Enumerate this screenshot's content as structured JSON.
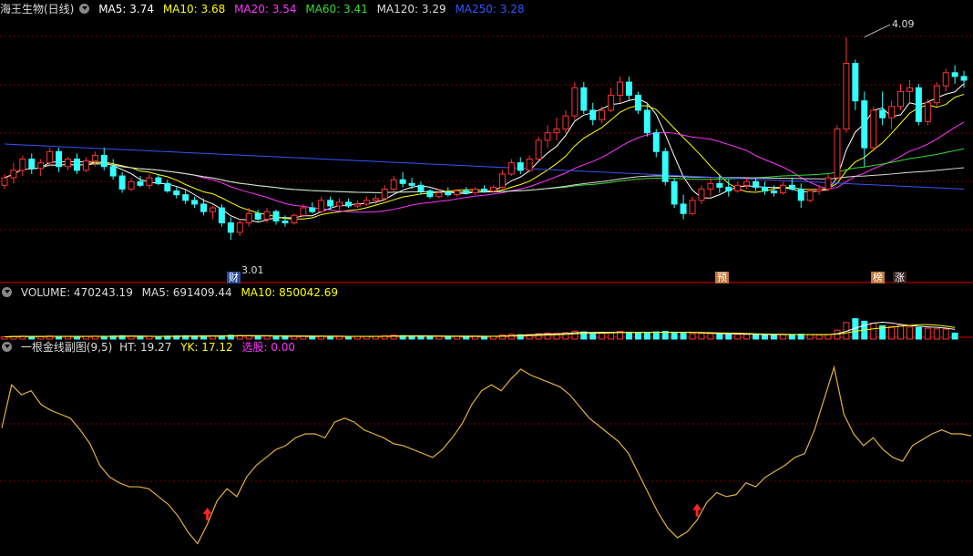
{
  "main": {
    "title": "海王生物(日线)",
    "ma": [
      {
        "label": "MA5: 3.74",
        "color": "#ffffff"
      },
      {
        "label": "MA10: 3.68",
        "color": "#ffff00"
      },
      {
        "label": "MA20: 3.54",
        "color": "#ff33ff"
      },
      {
        "label": "MA60: 3.41",
        "color": "#33dd33"
      },
      {
        "label": "MA120: 3.29",
        "color": "#dddddd"
      },
      {
        "label": "MA250: 3.28",
        "color": "#3355ff"
      }
    ],
    "high_label": "4.09",
    "low_label": "3.01",
    "tags": [
      {
        "text": "财",
        "bg": "#2a4fa0"
      },
      {
        "text": "预",
        "bg": "#c0783a"
      },
      {
        "text": "榜",
        "bg": "#c0783a"
      },
      {
        "text": "涨",
        "bg": "#3a2020"
      }
    ]
  },
  "volume": {
    "title": "VOLUME: 470243.19",
    "ma5": "MA5: 691409.44",
    "ma10": "MA10: 850042.69"
  },
  "indicator": {
    "title": "一根金线副图(9,5)",
    "ht": "HT: 19.27",
    "yk": "YK: 17.12",
    "xg": "选股: 0.00"
  },
  "colors": {
    "up": "#ff3333",
    "down": "#33ffff",
    "grid": "#7a0000",
    "gold": "#e0b040"
  },
  "chart_data": {
    "type": "candlestick",
    "price_range": [
      2.85,
      4.2
    ],
    "candles": [
      [
        3.3,
        3.36,
        3.28,
        3.34
      ],
      [
        3.34,
        3.42,
        3.31,
        3.38
      ],
      [
        3.38,
        3.46,
        3.35,
        3.44
      ],
      [
        3.44,
        3.47,
        3.36,
        3.39
      ],
      [
        3.39,
        3.44,
        3.35,
        3.42
      ],
      [
        3.42,
        3.5,
        3.4,
        3.48
      ],
      [
        3.48,
        3.5,
        3.37,
        3.4
      ],
      [
        3.4,
        3.45,
        3.38,
        3.44
      ],
      [
        3.44,
        3.47,
        3.36,
        3.38
      ],
      [
        3.38,
        3.45,
        3.37,
        3.43
      ],
      [
        3.43,
        3.48,
        3.4,
        3.46
      ],
      [
        3.46,
        3.5,
        3.38,
        3.4
      ],
      [
        3.4,
        3.44,
        3.33,
        3.35
      ],
      [
        3.35,
        3.37,
        3.26,
        3.28
      ],
      [
        3.28,
        3.34,
        3.27,
        3.32
      ],
      [
        3.32,
        3.35,
        3.29,
        3.3
      ],
      [
        3.3,
        3.36,
        3.28,
        3.34
      ],
      [
        3.34,
        3.36,
        3.3,
        3.31
      ],
      [
        3.31,
        3.33,
        3.26,
        3.27
      ],
      [
        3.27,
        3.29,
        3.23,
        3.25
      ],
      [
        3.25,
        3.28,
        3.2,
        3.22
      ],
      [
        3.22,
        3.24,
        3.18,
        3.2
      ],
      [
        3.2,
        3.23,
        3.14,
        3.16
      ],
      [
        3.16,
        3.19,
        3.12,
        3.18
      ],
      [
        3.18,
        3.2,
        3.08,
        3.1
      ],
      [
        3.1,
        3.13,
        3.01,
        3.05
      ],
      [
        3.05,
        3.12,
        3.03,
        3.1
      ],
      [
        3.1,
        3.18,
        3.08,
        3.15
      ],
      [
        3.15,
        3.17,
        3.11,
        3.12
      ],
      [
        3.12,
        3.18,
        3.1,
        3.16
      ],
      [
        3.16,
        3.17,
        3.09,
        3.11
      ],
      [
        3.11,
        3.14,
        3.08,
        3.1
      ],
      [
        3.1,
        3.15,
        3.09,
        3.14
      ],
      [
        3.14,
        3.2,
        3.13,
        3.18
      ],
      [
        3.18,
        3.21,
        3.15,
        3.16
      ],
      [
        3.16,
        3.24,
        3.15,
        3.22
      ],
      [
        3.22,
        3.24,
        3.17,
        3.19
      ],
      [
        3.19,
        3.23,
        3.17,
        3.21
      ],
      [
        3.21,
        3.23,
        3.18,
        3.19
      ],
      [
        3.19,
        3.22,
        3.18,
        3.2
      ],
      [
        3.2,
        3.24,
        3.19,
        3.22
      ],
      [
        3.22,
        3.25,
        3.2,
        3.23
      ],
      [
        3.23,
        3.3,
        3.22,
        3.28
      ],
      [
        3.28,
        3.35,
        3.27,
        3.33
      ],
      [
        3.33,
        3.37,
        3.29,
        3.31
      ],
      [
        3.31,
        3.34,
        3.28,
        3.3
      ],
      [
        3.3,
        3.32,
        3.25,
        3.27
      ],
      [
        3.27,
        3.28,
        3.23,
        3.24
      ],
      [
        3.24,
        3.28,
        3.23,
        3.26
      ],
      [
        3.26,
        3.29,
        3.24,
        3.25
      ],
      [
        3.25,
        3.28,
        3.24,
        3.27
      ],
      [
        3.27,
        3.29,
        3.25,
        3.26
      ],
      [
        3.26,
        3.29,
        3.25,
        3.28
      ],
      [
        3.28,
        3.3,
        3.26,
        3.27
      ],
      [
        3.27,
        3.3,
        3.26,
        3.29
      ],
      [
        3.29,
        3.38,
        3.28,
        3.36
      ],
      [
        3.36,
        3.44,
        3.35,
        3.42
      ],
      [
        3.42,
        3.45,
        3.36,
        3.38
      ],
      [
        3.38,
        3.46,
        3.37,
        3.44
      ],
      [
        3.44,
        3.56,
        3.43,
        3.54
      ],
      [
        3.54,
        3.62,
        3.5,
        3.58
      ],
      [
        3.58,
        3.66,
        3.54,
        3.6
      ],
      [
        3.6,
        3.7,
        3.58,
        3.67
      ],
      [
        3.67,
        3.85,
        3.65,
        3.82
      ],
      [
        3.82,
        3.85,
        3.68,
        3.7
      ],
      [
        3.7,
        3.74,
        3.62,
        3.65
      ],
      [
        3.65,
        3.72,
        3.63,
        3.7
      ],
      [
        3.7,
        3.82,
        3.69,
        3.78
      ],
      [
        3.78,
        3.88,
        3.74,
        3.85
      ],
      [
        3.85,
        3.88,
        3.75,
        3.78
      ],
      [
        3.78,
        3.8,
        3.68,
        3.7
      ],
      [
        3.7,
        3.74,
        3.56,
        3.58
      ],
      [
        3.58,
        3.6,
        3.45,
        3.48
      ],
      [
        3.48,
        3.5,
        3.3,
        3.32
      ],
      [
        3.32,
        3.34,
        3.18,
        3.2
      ],
      [
        3.2,
        3.25,
        3.12,
        3.15
      ],
      [
        3.15,
        3.24,
        3.14,
        3.22
      ],
      [
        3.22,
        3.3,
        3.2,
        3.28
      ],
      [
        3.28,
        3.34,
        3.24,
        3.31
      ],
      [
        3.31,
        3.36,
        3.26,
        3.29
      ],
      [
        3.29,
        3.33,
        3.24,
        3.27
      ],
      [
        3.27,
        3.32,
        3.26,
        3.3
      ],
      [
        3.3,
        3.34,
        3.28,
        3.32
      ],
      [
        3.32,
        3.34,
        3.27,
        3.29
      ],
      [
        3.29,
        3.32,
        3.25,
        3.27
      ],
      [
        3.27,
        3.3,
        3.24,
        3.26
      ],
      [
        3.26,
        3.32,
        3.25,
        3.3
      ],
      [
        3.3,
        3.34,
        3.27,
        3.28
      ],
      [
        3.28,
        3.31,
        3.18,
        3.22
      ],
      [
        3.22,
        3.28,
        3.21,
        3.27
      ],
      [
        3.27,
        3.3,
        3.25,
        3.28
      ],
      [
        3.28,
        3.36,
        3.27,
        3.34
      ],
      [
        3.34,
        3.62,
        3.33,
        3.6
      ],
      [
        3.6,
        4.09,
        3.58,
        3.95
      ],
      [
        3.95,
        3.97,
        3.7,
        3.75
      ],
      [
        3.75,
        3.8,
        3.4,
        3.5
      ],
      [
        3.5,
        3.72,
        3.48,
        3.7
      ],
      [
        3.7,
        3.8,
        3.62,
        3.66
      ],
      [
        3.66,
        3.75,
        3.6,
        3.72
      ],
      [
        3.72,
        3.84,
        3.7,
        3.8
      ],
      [
        3.8,
        3.86,
        3.74,
        3.82
      ],
      [
        3.82,
        3.84,
        3.62,
        3.64
      ],
      [
        3.64,
        3.76,
        3.62,
        3.74
      ],
      [
        3.74,
        3.85,
        3.72,
        3.83
      ],
      [
        3.83,
        3.92,
        3.8,
        3.9
      ],
      [
        3.9,
        3.94,
        3.84,
        3.88
      ],
      [
        3.88,
        3.91,
        3.82,
        3.86
      ]
    ],
    "volume_range": [
      0,
      3000000
    ],
    "volumes": [
      180000,
      210000,
      230000,
      200000,
      190000,
      240000,
      220000,
      200000,
      190000,
      210000,
      230000,
      220000,
      240000,
      260000,
      220000,
      200000,
      210000,
      190000,
      230000,
      250000,
      260000,
      240000,
      250000,
      230000,
      260000,
      300000,
      280000,
      260000,
      240000,
      230000,
      220000,
      200000,
      210000,
      230000,
      210000,
      240000,
      220000,
      200000,
      190000,
      200000,
      210000,
      220000,
      260000,
      300000,
      270000,
      240000,
      230000,
      220000,
      210000,
      200000,
      210000,
      200000,
      220000,
      210000,
      230000,
      320000,
      380000,
      340000,
      360000,
      420000,
      480000,
      450000,
      500000,
      620000,
      560000,
      480000,
      460000,
      520000,
      600000,
      540000,
      480000,
      520000,
      560000,
      600000,
      540000,
      460000,
      420000,
      440000,
      430000,
      400000,
      380000,
      370000,
      360000,
      350000,
      340000,
      330000,
      360000,
      340000,
      380000,
      350000,
      330000,
      360000,
      700000,
      1300000,
      1600000,
      1400000,
      1250000,
      1050000,
      980000,
      1100000,
      950000,
      900000,
      850000,
      800000,
      780000,
      470000
    ],
    "indicator_range": [
      0,
      100
    ],
    "indicator": [
      63,
      85,
      80,
      82,
      75,
      72,
      70,
      68,
      62,
      55,
      44,
      38,
      35,
      33,
      33,
      32,
      28,
      24,
      18,
      10,
      4,
      14,
      26,
      32,
      28,
      38,
      44,
      48,
      52,
      54,
      58,
      60,
      60,
      58,
      66,
      68,
      66,
      62,
      60,
      58,
      55,
      54,
      52,
      50,
      48,
      52,
      58,
      65,
      75,
      82,
      85,
      82,
      88,
      93,
      90,
      88,
      86,
      84,
      80,
      74,
      68,
      64,
      60,
      56,
      50,
      40,
      30,
      20,
      12,
      7,
      10,
      16,
      25,
      30,
      28,
      29,
      35,
      33,
      38,
      41,
      44,
      48,
      50,
      62,
      78,
      94,
      70,
      60,
      54,
      58,
      52,
      48,
      46,
      54,
      57,
      60,
      62,
      60,
      60,
      59
    ],
    "buy_signals": [
      21,
      71
    ],
    "indicator_values": {
      "ht": 19.27,
      "yk": 17.12,
      "xg": 0.0
    }
  }
}
